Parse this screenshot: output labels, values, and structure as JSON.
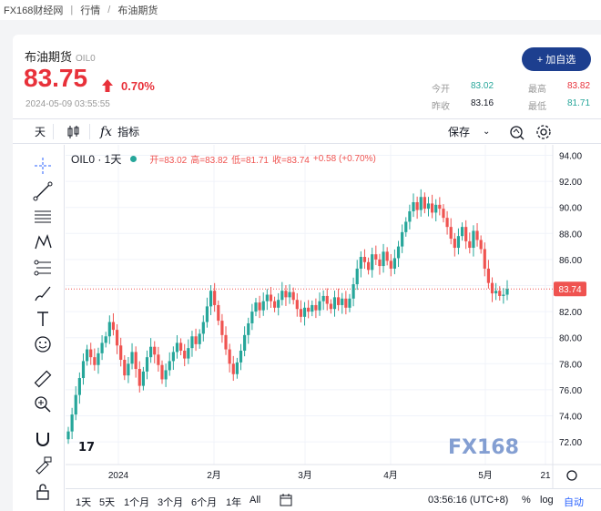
{
  "breadcrumb": {
    "site": "FX168财经网",
    "section": "行情",
    "page": "布油期货"
  },
  "header": {
    "name": "布油期货",
    "code": "OIL0",
    "price": "83.75",
    "change_pct": "0.70%",
    "timestamp": "2024-05-09 03:55:55",
    "add_watch": "+ 加自选",
    "stats": {
      "open_label": "今开",
      "open": "83.02",
      "high_label": "最高",
      "high": "83.82",
      "prev_label": "昨收",
      "prev": "83.16",
      "low_label": "最低",
      "low": "81.71"
    }
  },
  "toolbar": {
    "interval": "天",
    "indicators": "指标",
    "save": "保存"
  },
  "legend": {
    "symbol": "OIL0 · 1天",
    "open": "开=83.02",
    "high": "高=83.82",
    "low": "低=81.71",
    "close": "收=83.74",
    "change": "+0.58 (+0.70%)"
  },
  "chart_data": {
    "type": "candlestick",
    "ylim": [
      70.5,
      95
    ],
    "y_ticks": [
      "94.00",
      "92.00",
      "90.00",
      "88.00",
      "86.00",
      "84.00",
      "82.00",
      "80.00",
      "78.00",
      "76.00",
      "74.00",
      "72.00"
    ],
    "x_tick_labels": [
      "2024",
      "2月",
      "3月",
      "4月",
      "5月",
      "21"
    ],
    "last_price_label": "83.74",
    "watermark": "FX168",
    "up_color": "#26a69a",
    "down_color": "#ef5350",
    "closes": [
      72.8,
      74.1,
      75.6,
      76.9,
      78.2,
      79.1,
      78.5,
      77.9,
      78.8,
      79.6,
      80.1,
      81.2,
      80.6,
      79.4,
      78.3,
      77.1,
      78.0,
      78.9,
      77.6,
      76.3,
      77.4,
      78.5,
      79.3,
      78.7,
      77.9,
      76.8,
      77.5,
      78.2,
      78.9,
      79.6,
      79.0,
      78.4,
      79.2,
      80.1,
      79.5,
      80.3,
      81.2,
      82.4,
      83.6,
      82.5,
      81.3,
      80.2,
      79.1,
      78.0,
      77.2,
      78.1,
      79.0,
      80.2,
      81.1,
      82.0,
      82.7,
      82.1,
      82.8,
      83.3,
      82.8,
      82.3,
      82.9,
      83.6,
      83.1,
      83.5,
      82.9,
      82.2,
      81.6,
      82.3,
      82.0,
      82.5,
      82.1,
      82.8,
      83.2,
      82.6,
      82.2,
      83.1,
      82.5,
      83.0,
      82.3,
      83.0,
      84.1,
      85.3,
      86.2,
      85.8,
      85.2,
      86.4,
      86.0,
      85.5,
      86.6,
      85.9,
      85.3,
      86.1,
      87.0,
      88.1,
      88.9,
      89.7,
      90.4,
      89.8,
      90.8,
      89.9,
      90.3,
      89.6,
      90.2,
      89.9,
      89.2,
      88.5,
      87.6,
      86.9,
      87.8,
      88.5,
      87.4,
      86.9,
      88.2,
      87.5,
      86.8,
      85.3,
      84.2,
      83.4,
      83.6,
      83.2,
      83.3,
      83.74
    ]
  },
  "left_tools": [
    "crosshair-icon",
    "trendline-icon",
    "fib-icon",
    "pattern-icon",
    "ruler-lines-icon",
    "brush-icon",
    "text-icon",
    "emoji-icon",
    "measure-icon",
    "zoom-icon",
    "magnet-icon",
    "lock-draw-icon",
    "lock-icon"
  ],
  "bottom": {
    "ranges": [
      "1天",
      "5天",
      "1个月",
      "3个月",
      "6个月",
      "1年",
      "All"
    ],
    "clock": "03:56:16 (UTC+8)",
    "pct": "%",
    "log": "log",
    "auto": "自动"
  }
}
